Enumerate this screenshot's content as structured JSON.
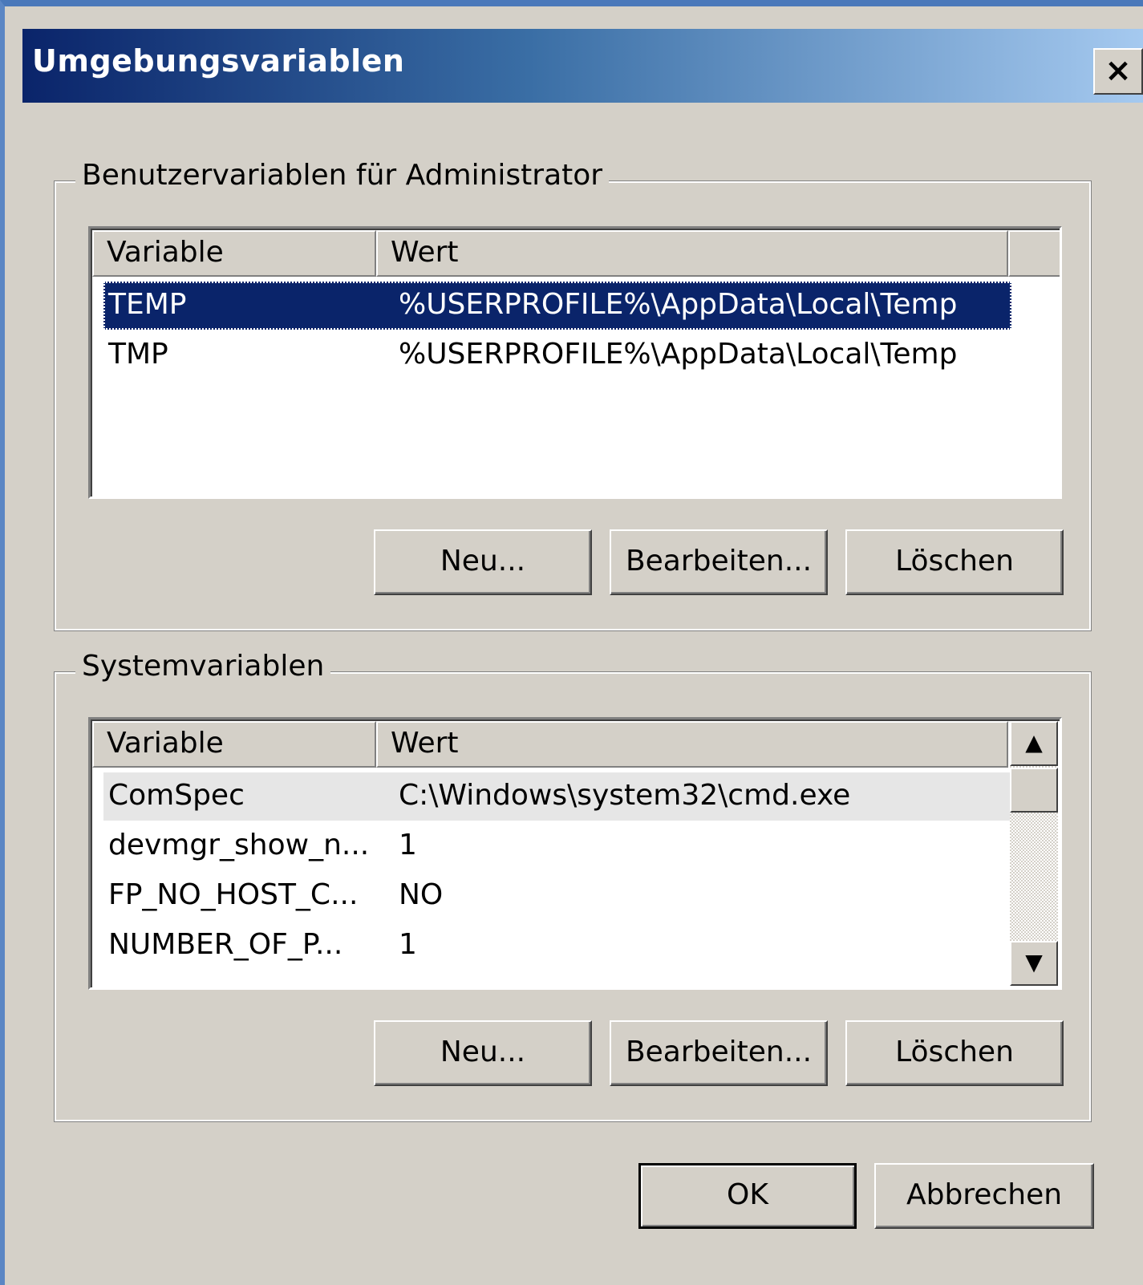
{
  "window": {
    "title": "Umgebungsvariablen",
    "close_label": "×"
  },
  "user_vars": {
    "group_label": "Benutzervariablen für Administrator",
    "columns": [
      "Variable",
      "Wert"
    ],
    "rows": [
      {
        "variable": "TEMP",
        "value": "%USERPROFILE%\\AppData\\Local\\Temp",
        "selected": true
      },
      {
        "variable": "TMP",
        "value": "%USERPROFILE%\\AppData\\Local\\Temp",
        "selected": false
      }
    ],
    "buttons": {
      "new": "Neu...",
      "edit": "Bearbeiten...",
      "delete": "Löschen"
    }
  },
  "system_vars": {
    "group_label": "Systemvariablen",
    "columns": [
      "Variable",
      "Wert"
    ],
    "rows": [
      {
        "variable": "ComSpec",
        "value": "C:\\Windows\\system32\\cmd.exe"
      },
      {
        "variable": "devmgr_show_n...",
        "value": "1"
      },
      {
        "variable": "FP_NO_HOST_C...",
        "value": "NO"
      },
      {
        "variable": "NUMBER_OF_P...",
        "value": "1"
      }
    ],
    "scroll_up_icon": "▲",
    "scroll_down_icon": "▼",
    "buttons": {
      "new": "Neu...",
      "edit": "Bearbeiten...",
      "delete": "Löschen"
    }
  },
  "footer": {
    "ok": "OK",
    "cancel": "Abbrechen"
  }
}
